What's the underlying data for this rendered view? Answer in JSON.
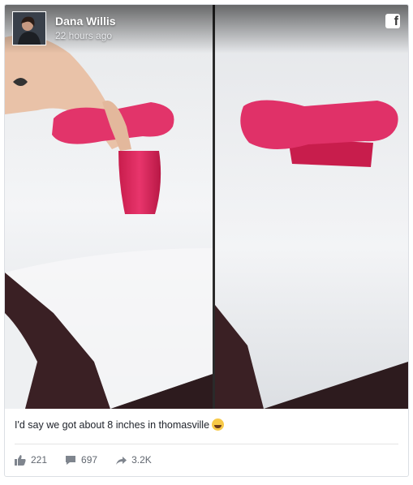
{
  "post": {
    "author": "Dana Willis",
    "time": "22 hours ago",
    "network_icon": "facebook-icon",
    "network_glyph": "f",
    "caption": "I'd say we got about 8 inches in thomasville",
    "caption_emoji": "tears-of-joy-emoji"
  },
  "stats": {
    "likes": "221",
    "comments": "697",
    "shares": "3.2K"
  },
  "colors": {
    "snow": "#f2f4f6",
    "pink_object": "#d9285a",
    "text_dark": "#1d2129",
    "text_muted": "#616770"
  }
}
